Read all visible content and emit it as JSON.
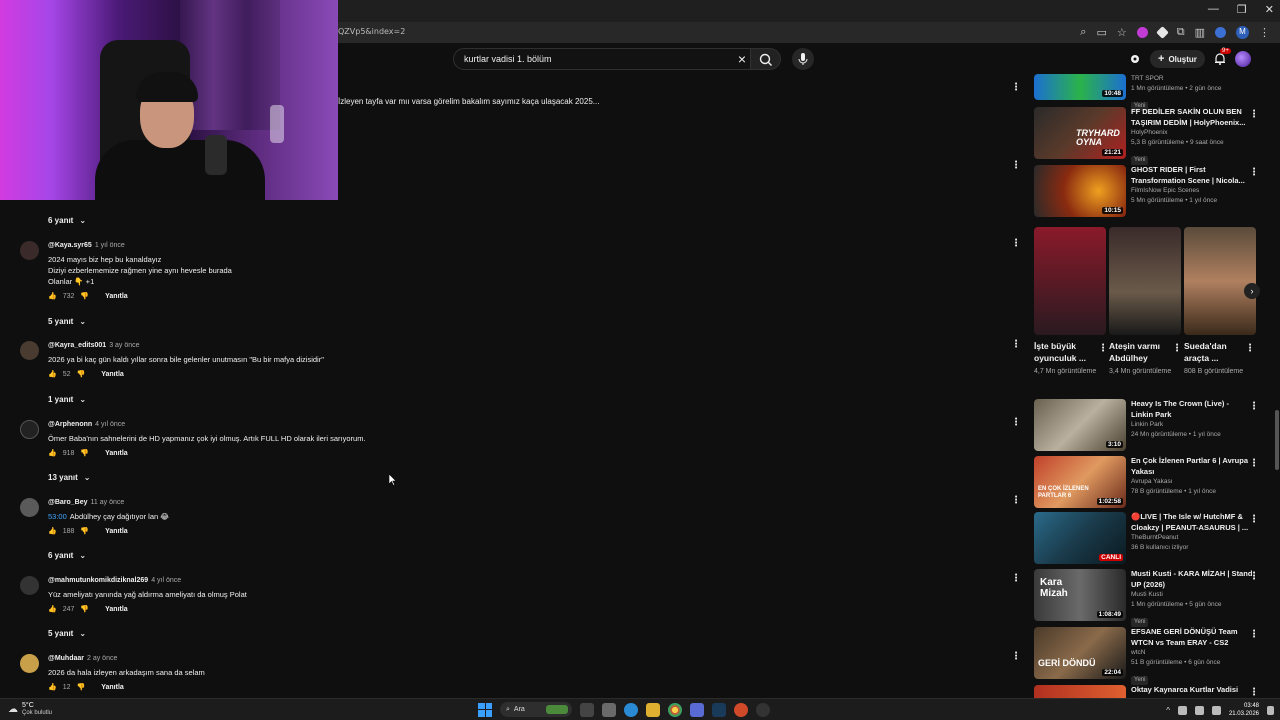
{
  "browser": {
    "url_fragment": "QZVp5&index=2",
    "window_controls": [
      "—",
      "❐",
      "✕"
    ]
  },
  "header": {
    "search_value": "kurtlar vadisi 1. bölüm",
    "create_label": "Oluştur",
    "notification_count": "9+"
  },
  "top_comment_text": "İzleyen tayfa var mıı varsa görelim bakalım sayımız kaça ulaşacak 2025...",
  "comments": [
    {
      "replies_label_before": "6 yanıt"
    },
    {
      "user": "@Kaya.syr65",
      "time": "1 yıl önce",
      "lines": [
        "2024 mayıs biz hep bu kanaldayız",
        "Diziyi ezberlememize rağmen yine aynı hevesle burada",
        "Olanlar 👇 +1"
      ],
      "likes": "732",
      "reply_label": "Yanıtla",
      "replies_label": "5 yanıt"
    },
    {
      "user": "@Kayra_edits001",
      "time": "3 ay önce",
      "lines": [
        "2026 ya bi kaç gün kaldı yıllar sonra bile gelenler unutmasın \"Bu bir mafya dizisidir\""
      ],
      "likes": "52",
      "reply_label": "Yanıtla",
      "replies_label": "1 yanıt"
    },
    {
      "user": "@Arphenonn",
      "time": "4 yıl önce",
      "lines": [
        "Ömer Baba'nın sahnelerini de HD yapmanız çok iyi olmuş. Artık FULL HD olarak ileri sarıyorum."
      ],
      "likes": "918",
      "reply_label": "Yanıtla",
      "replies_label": "13 yanıt"
    },
    {
      "user": "@Baro_Bey",
      "time": "11 ay önce",
      "timestamp": "53:00",
      "lines": [
        "Abdülhey çay dağıtıyor lan 😂"
      ],
      "likes": "188",
      "reply_label": "Yanıtla",
      "replies_label": "6 yanıt"
    },
    {
      "user": "@mahmutunkomikdiziknal269",
      "time": "4 yıl önce",
      "lines": [
        "Yüz ameliyatı yanında yağ aldırma ameliyatı da olmuş Polat"
      ],
      "likes": "247",
      "reply_label": "Yanıtla",
      "replies_label": "5 yanıt"
    },
    {
      "user": "@Muhdaar",
      "time": "2 ay önce",
      "lines": [
        "2026 da hala izleyen arkadaşım sana da selam"
      ],
      "likes": "12",
      "reply_label": "Yanıtla"
    }
  ],
  "sidebar": {
    "videos_top": [
      {
        "channel": "TRT SPOR",
        "meta": "1 Mn görüntüleme • 2 gün önce",
        "badge": "Yeni",
        "duration": "10:48"
      },
      {
        "title": "FF DEDİLER SAKİN OLUN BEN TAŞIRIM DEDİM | HolyPhoenix...",
        "channel": "HolyPhoenix",
        "meta": "5,3 B görüntüleme • 9 saat önce",
        "badge": "Yeni",
        "duration": "21:21",
        "thumb_text": "TRYHARD OYNA"
      },
      {
        "title": "GHOST RIDER | First Transformation Scene | Nicola...",
        "channel": "FilmIsNow Epic Scenes",
        "meta": "5 Mn görüntüleme • 1 yıl önce",
        "duration": "10:15"
      }
    ],
    "shorts": [
      {
        "title": "İşte büyük oyunculuk ...",
        "views": "4,7 Mn görüntüleme"
      },
      {
        "title": "Ateşin varmı Abdülhey",
        "views": "3,4 Mn görüntüleme"
      },
      {
        "title": "Sueda'dan araçta ...",
        "views": "808 B görüntüleme"
      }
    ],
    "videos_bottom": [
      {
        "title": "Heavy Is The Crown (Live) - Linkin Park",
        "channel": "Linkin Park",
        "meta": "24 Mn görüntüleme • 1 yıl önce",
        "duration": "3:10"
      },
      {
        "title": "En Çok İzlenen Partlar 6 | Avrupa Yakası",
        "channel": "Avrupa Yakası",
        "meta": "78 B görüntüleme • 1 yıl önce",
        "duration": "1:02:58",
        "thumb_text": "EN ÇOK İZLENEN PARTLAR 6"
      },
      {
        "title": "🔴LIVE | The Isle w/ HutchMF & Cloakzy | PEANUT-ASAURUS | ...",
        "channel": "TheBurntPeanut",
        "meta": "36 B kullanıcı izliyor",
        "duration": "CANLI"
      },
      {
        "title": "Musti Kusti - KARA MİZAH | Stand UP (2026)",
        "channel": "Musti Kusti",
        "meta": "1 Mn görüntüleme • 5 gün önce",
        "badge": "Yeni",
        "duration": "1:08:49",
        "thumb_text": "Kara Mizah"
      },
      {
        "title": "EFSANE GERİ DÖNÜŞÜ Team WTCN vs Team ERAY - CS2",
        "channel": "wtcN",
        "meta": "51 B görüntüleme • 6 gün önce",
        "badge": "Yeni",
        "duration": "22:04",
        "thumb_text": "GERİ DÖNDÜ"
      },
      {
        "title": "Oktay Kaynarca Kurtlar Vadisi"
      }
    ]
  },
  "taskbar": {
    "temp": "5°C",
    "weather": "Çok bulutlu",
    "search_label": "Ara",
    "time": "03:48",
    "date": "21.03.2026"
  },
  "colors": {
    "accent_blue": "#3ea6ff",
    "live_red": "#cc0000",
    "background": "#0f0f0f"
  }
}
